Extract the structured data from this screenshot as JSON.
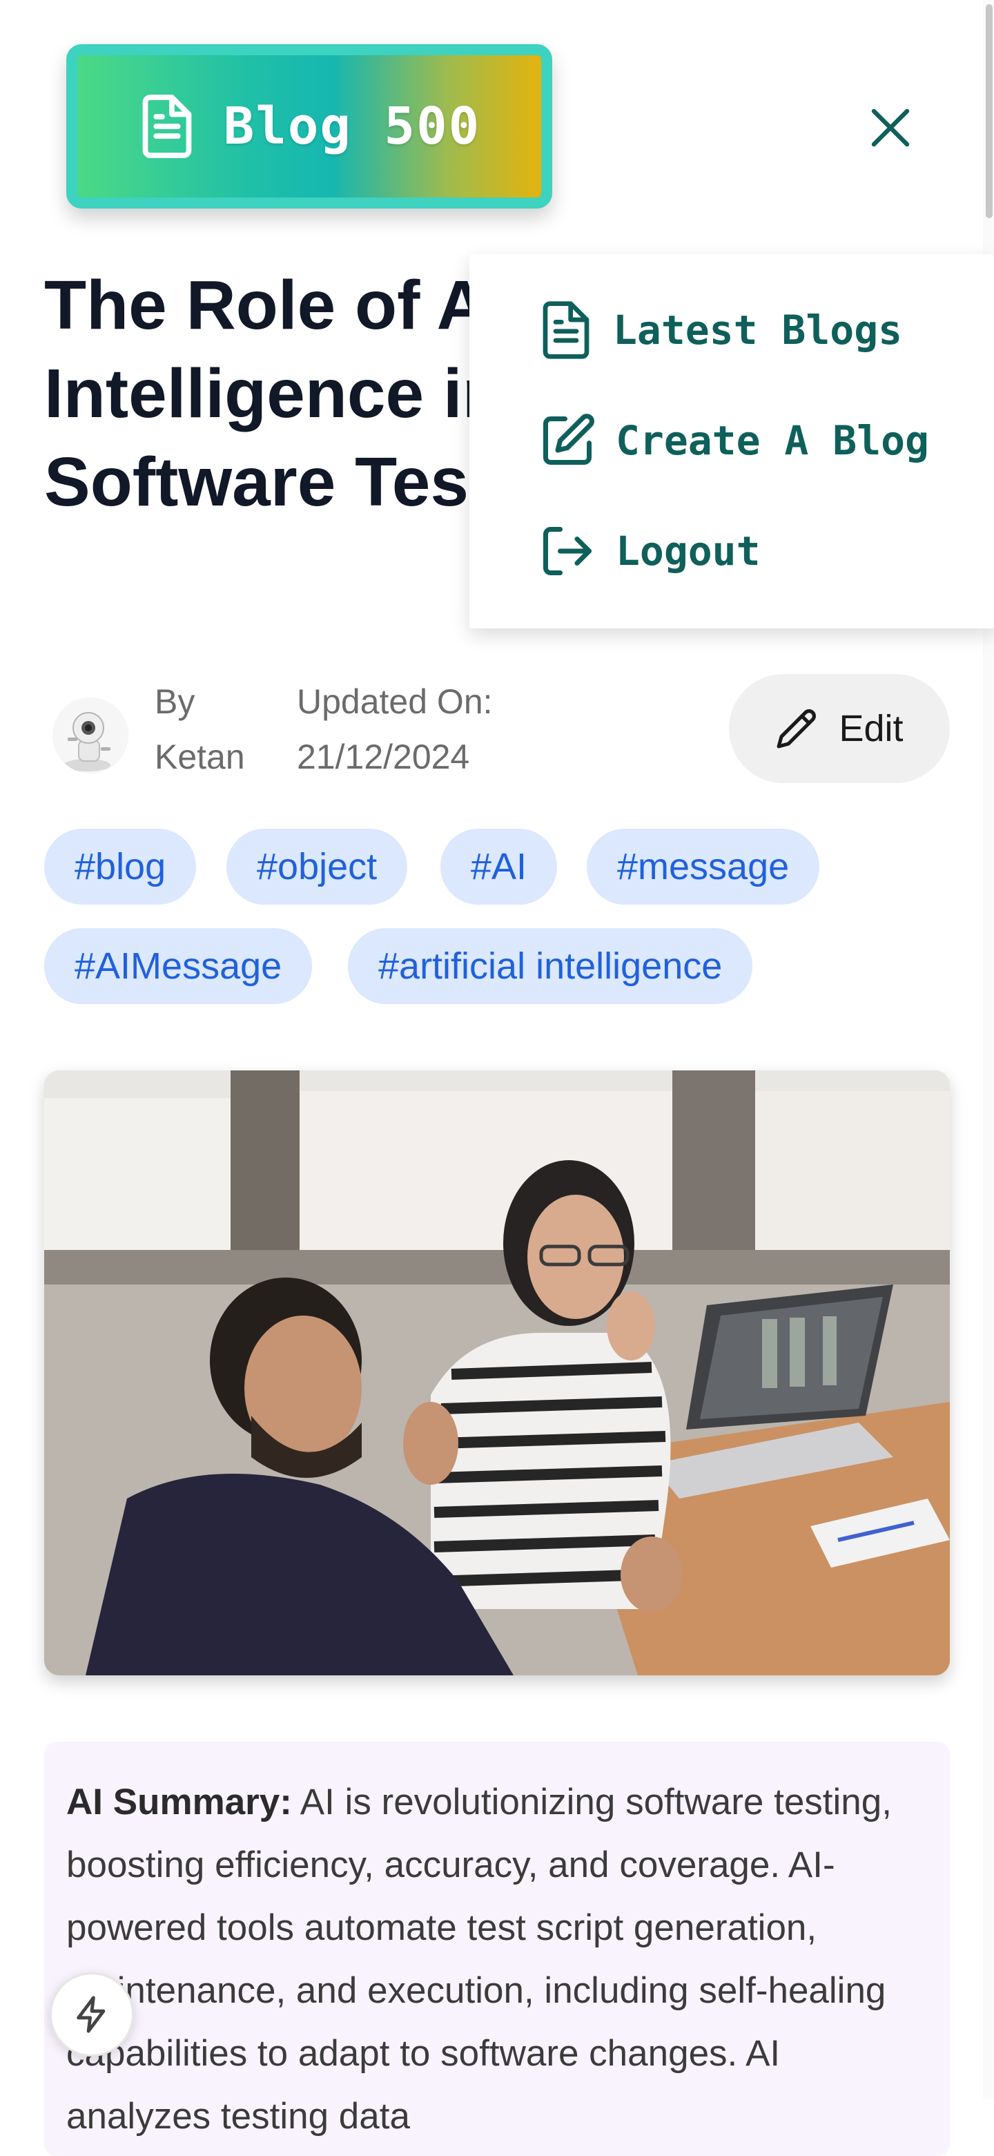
{
  "logo": {
    "text": "Blog 500",
    "icon": "document-icon"
  },
  "close": {
    "icon": "close-icon"
  },
  "article": {
    "title": "The Role of Artificial Intelligence in Enhancing Software Testing",
    "author_prefix": "By",
    "author": "Ketan",
    "updated_label": "Updated On:",
    "updated_date": "21/12/2024",
    "edit_label": "Edit"
  },
  "menu": {
    "items": [
      {
        "label": "Latest Blogs",
        "icon": "document-icon"
      },
      {
        "label": "Create A Blog",
        "icon": "edit-square-icon"
      },
      {
        "label": "Logout",
        "icon": "logout-icon"
      }
    ]
  },
  "tags": [
    "#blog",
    "#object",
    "#AI",
    "#message",
    "#AIMessage",
    "#artificial intelligence"
  ],
  "summary": {
    "label": "AI Summary:",
    "text": "AI is revolutionizing software testing, boosting efficiency, accuracy, and coverage. AI-powered tools automate test script generation, maintenance, and execution, including self-healing capabilities to adapt to software changes. AI analyzes testing data"
  },
  "colors": {
    "accent_dark": "#0f5f5a",
    "tag_bg": "#dbe8fd",
    "tag_text": "#2060dc",
    "summary_bg": "#f9f3fd"
  }
}
